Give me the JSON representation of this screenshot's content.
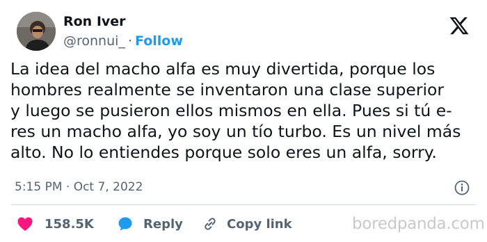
{
  "author": {
    "name": "Ron Iver",
    "handle": "@ronnui_",
    "separator": "·",
    "follow_label": "Follow"
  },
  "logo_icon": "x-logo-icon",
  "tweet": {
    "lines": [
      "La idea del macho alfa es muy divertida, porque los",
      "hombres realmente se inventaron una clase superior",
      "y luego se pusieron ellos mismos en ella. Pues si tú e-",
      "res un macho alfa, yo soy un tío turbo. Es un nivel más",
      "alto. No lo entiendes porque solo eres un alfa, sorry."
    ]
  },
  "timestamp": "5:15 PM · Oct 7, 2022",
  "actions": {
    "likes": "158.5K",
    "reply_label": "Reply",
    "copy_label": "Copy link"
  },
  "watermark": "boredpanda.com",
  "colors": {
    "text": "#0f1419",
    "muted": "#536471",
    "link": "#1d9bf0",
    "heart": "#f91880"
  }
}
